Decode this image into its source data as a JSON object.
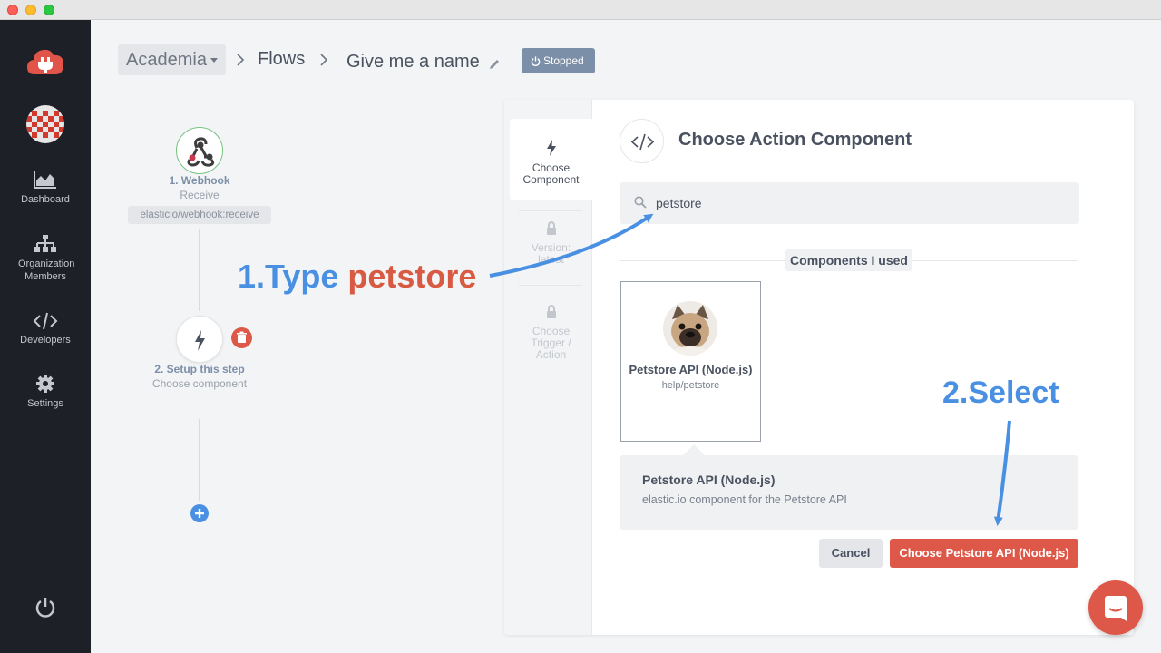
{
  "sidebar": {
    "items": [
      {
        "label": "Dashboard",
        "icon": "chart-area-icon"
      },
      {
        "label": "Organization Members",
        "icon": "sitemap-icon"
      },
      {
        "label": "Developers",
        "icon": "code-icon"
      },
      {
        "label": "Settings",
        "icon": "gear-icon"
      }
    ],
    "bottom_icon": "power-icon"
  },
  "header": {
    "org": "Academia",
    "flows": "Flows",
    "flow_name": "Give me a name",
    "status": "Stopped"
  },
  "flow": {
    "step1": {
      "title": "1. Webhook",
      "subtitle": "Receive",
      "tag": "elasticio/webhook:receive"
    },
    "step2": {
      "title": "2. Setup this step",
      "subtitle": "Choose component"
    }
  },
  "steps_nav": [
    {
      "label": "Choose Component",
      "state": "active"
    },
    {
      "label": "Version: latest",
      "state": "locked"
    },
    {
      "label": "Choose Trigger / Action",
      "state": "locked"
    }
  ],
  "panel": {
    "title": "Choose Action Component",
    "search_value": "petstore",
    "section_label": "Components I used",
    "card": {
      "name": "Petstore API (Node.js)",
      "path": "help/petstore"
    },
    "detail": {
      "title": "Petstore API (Node.js)",
      "description": "elastic.io component for the Petstore API"
    },
    "cancel_label": "Cancel",
    "choose_label": "Choose Petstore API (Node.js)"
  },
  "annotations": {
    "step1_prefix": "1.Type ",
    "step1_word": "petstore",
    "step2": "2.Select"
  },
  "colors": {
    "sidebar_bg": "#1d2027",
    "brand_red": "#de5849",
    "status_badge": "#7c8fa8",
    "annotation_blue": "#4a90e2"
  }
}
